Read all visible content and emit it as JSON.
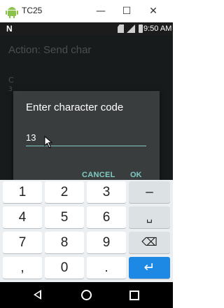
{
  "window": {
    "title": "TC25",
    "minimize_glyph": "—",
    "maximize_glyph": "☐",
    "close_glyph": "✕"
  },
  "status_bar": {
    "notification_icon": "N",
    "time": "9:50 AM",
    "icons": [
      "no-sim-icon",
      "signal-icon",
      "battery-icon"
    ]
  },
  "background_app": {
    "header": "Action: Send char",
    "row_label": "C",
    "row_sub": "3"
  },
  "dialog": {
    "title": "Enter character code",
    "input_value": "13",
    "cancel_label": "CANCEL",
    "ok_label": "OK",
    "accent_color": "#80cbc4"
  },
  "keyboard": {
    "rows": [
      [
        "1",
        "2",
        "3",
        "–"
      ],
      [
        "4",
        "5",
        "6",
        "␣"
      ],
      [
        "7",
        "8",
        "9",
        "⌫"
      ],
      [
        ",",
        "0",
        ".",
        "↵"
      ]
    ],
    "enter_color": "#1e88e5"
  },
  "nav_bar": {
    "icons": [
      "back-icon",
      "home-icon",
      "recents-icon"
    ]
  }
}
